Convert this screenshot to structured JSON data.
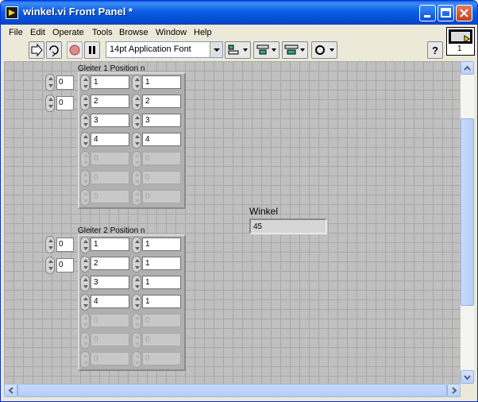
{
  "window": {
    "title": "winkel.vi Front Panel *"
  },
  "menu": [
    {
      "id": "file",
      "label": "File"
    },
    {
      "id": "edit",
      "label": "Edit"
    },
    {
      "id": "operate",
      "label": "Operate"
    },
    {
      "id": "tools",
      "label": "Tools"
    },
    {
      "id": "browse",
      "label": "Browse"
    },
    {
      "id": "window",
      "label": "Window"
    },
    {
      "id": "help",
      "label": "Help"
    }
  ],
  "toolbar": {
    "font_selector": "14pt Application Font",
    "icons": [
      "run-arrow-icon",
      "run-continuous-icon",
      "abort-icon",
      "pause-icon",
      "align-objects-icon",
      "distribute-objects-icon",
      "resize-objects-icon",
      "reorder-icon",
      "context-help-icon"
    ]
  },
  "vi_icon_label": "1",
  "arrays": [
    {
      "label": "Gleiter 1 Position n",
      "index": [
        "0",
        "0"
      ],
      "rows": [
        [
          "1",
          "1"
        ],
        [
          "2",
          "2"
        ],
        [
          "3",
          "3"
        ],
        [
          "4",
          "4"
        ],
        [
          "0",
          "0"
        ],
        [
          "0",
          "0"
        ],
        [
          "0",
          "0"
        ]
      ],
      "active_rows": 4
    },
    {
      "label": "Gleiter 2 Position n",
      "index": [
        "0",
        "0"
      ],
      "rows": [
        [
          "1",
          "1"
        ],
        [
          "2",
          "1"
        ],
        [
          "3",
          "1"
        ],
        [
          "4",
          "1"
        ],
        [
          "0",
          "0"
        ],
        [
          "0",
          "0"
        ],
        [
          "0",
          "0"
        ]
      ],
      "active_rows": 4
    }
  ],
  "winkel": {
    "label": "Winkel",
    "value": "45"
  },
  "colors": {
    "title_bar": "#0a5fe6",
    "panel_bg": "#c0c0c0",
    "grid": "#a8a8a8"
  }
}
